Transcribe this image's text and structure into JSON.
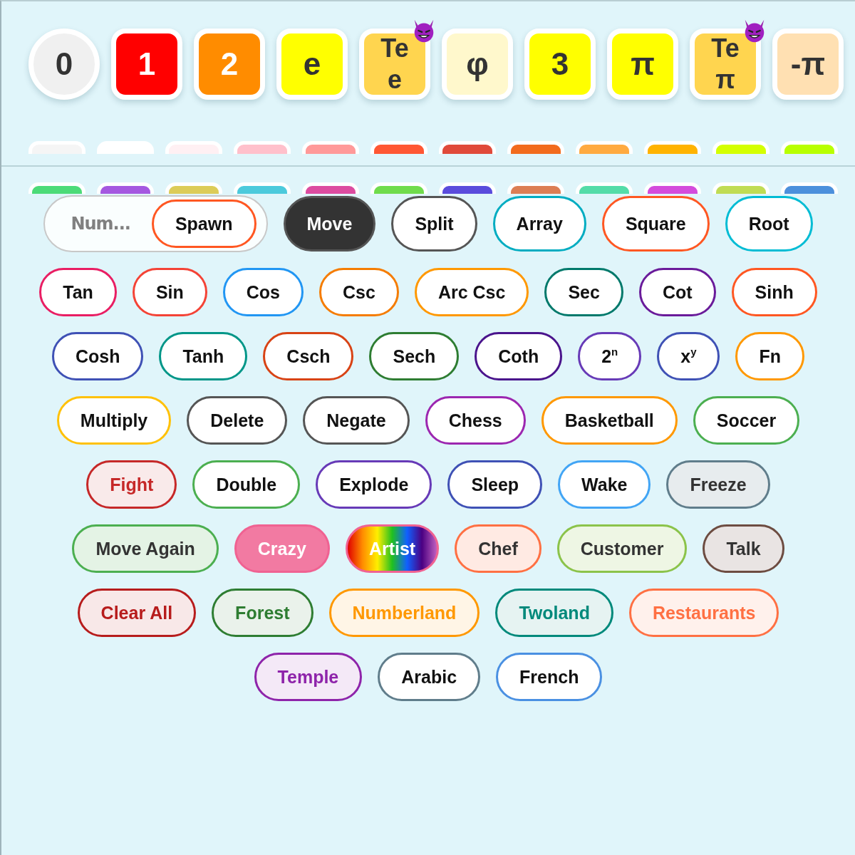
{
  "tiles": [
    {
      "label": "0",
      "kind": "circle",
      "color": "#f0f0f0"
    },
    {
      "label": "1",
      "kind": "square",
      "color": "#ff0000"
    },
    {
      "label": "2",
      "kind": "square",
      "color": "#ff8c00"
    },
    {
      "label": "e",
      "kind": "square",
      "color": "#ffff00"
    },
    {
      "label": "Te",
      "sublabel": "e",
      "kind": "square",
      "color": "#ffd54f",
      "badge": true
    },
    {
      "label": "φ",
      "kind": "square",
      "color": "#fff8cc"
    },
    {
      "label": "3",
      "kind": "square",
      "color": "#ffff00"
    },
    {
      "label": "π",
      "kind": "square",
      "color": "#ffff00"
    },
    {
      "label": "Te",
      "sublabel": "π",
      "kind": "square",
      "color": "#ffd54f",
      "badge": true
    },
    {
      "label": "-π",
      "kind": "square",
      "color": "#ffe0b2"
    }
  ],
  "swatch_rows": [
    [
      {
        "color": "#f5f5f5"
      },
      {
        "color": "#ffffff"
      },
      {
        "color": "#fff0f3"
      },
      {
        "color": "#ffc0cb"
      },
      {
        "color": "#ff9999"
      },
      {
        "color": "#ff5733"
      },
      {
        "color": "#e04a3a"
      },
      {
        "color": "#f26b1d"
      },
      {
        "color": "#ffaa40"
      },
      {
        "color": "#ffb300"
      },
      {
        "color": "#d4ff00"
      },
      {
        "color": "#b8ff00"
      }
    ],
    [
      {
        "color": "#4cdb78"
      },
      {
        "color": "#a558e0"
      },
      {
        "color": "#dccc58"
      },
      {
        "color": "#4ccadc"
      },
      {
        "color": "#dc4ca0"
      },
      {
        "color": "#70dc4c"
      },
      {
        "color": "#5a4cdc"
      },
      {
        "color": "#dc7e54"
      },
      {
        "color": "#54dca8"
      },
      {
        "color": "#d44cdc"
      },
      {
        "color": "#c0dc54"
      },
      {
        "color": "#4c90dc"
      }
    ]
  ],
  "button_rows": [
    [
      {
        "kind": "group",
        "label": "Num...",
        "button": {
          "label": "Spawn",
          "kind": "outline",
          "color": "#ff5722"
        }
      },
      {
        "label": "Move",
        "kind": "dark",
        "color": "#555555"
      },
      {
        "label": "Split",
        "kind": "outline",
        "color": "#555555"
      },
      {
        "label": "Array",
        "kind": "outline",
        "color": "#00acc1"
      },
      {
        "label": "Square",
        "kind": "outline",
        "color": "#ff5722"
      },
      {
        "label": "Root",
        "kind": "outline",
        "color": "#00bcd4"
      }
    ],
    [
      {
        "label": "Tan",
        "kind": "outline",
        "color": "#e91e63"
      },
      {
        "label": "Sin",
        "kind": "outline",
        "color": "#f44336"
      },
      {
        "label": "Cos",
        "kind": "outline",
        "color": "#2196f3"
      },
      {
        "label": "Csc",
        "kind": "outline",
        "color": "#f57c00"
      },
      {
        "label": "Arc Csc",
        "kind": "outline",
        "color": "#ff9800"
      },
      {
        "label": "Sec",
        "kind": "outline",
        "color": "#00796b"
      },
      {
        "label": "Cot",
        "kind": "outline",
        "color": "#6a1b9a"
      },
      {
        "label": "Sinh",
        "kind": "outline",
        "color": "#ff5722"
      }
    ],
    [
      {
        "label": "Cosh",
        "kind": "outline",
        "color": "#3f51b5"
      },
      {
        "label": "Tanh",
        "kind": "outline",
        "color": "#009688"
      },
      {
        "label": "Csch",
        "kind": "outline",
        "color": "#d84315"
      },
      {
        "label": "Sech",
        "kind": "outline",
        "color": "#2e7d32"
      },
      {
        "label": "Coth",
        "kind": "outline",
        "color": "#4a148c"
      },
      {
        "label": "2$^{n}$",
        "kind": "outline",
        "color": "#673ab7"
      },
      {
        "label": "x$^{y}$",
        "kind": "outline",
        "color": "#3f51b5"
      },
      {
        "label": "Fn",
        "kind": "outline",
        "color": "#ff9800"
      }
    ],
    [
      {
        "label": "Multiply",
        "kind": "outline",
        "color": "#ffc107"
      },
      {
        "label": "Delete",
        "kind": "outline",
        "color": "#555555"
      },
      {
        "label": "Negate",
        "kind": "outline",
        "color": "#555555"
      },
      {
        "label": "Chess",
        "kind": "outline",
        "color": "#9c27b0"
      },
      {
        "label": "Basketball",
        "kind": "outline",
        "color": "#ff9800"
      },
      {
        "label": "Soccer",
        "kind": "outline",
        "color": "#4caf50"
      }
    ],
    [
      {
        "label": "Fight",
        "kind": "tinted",
        "color": "#c62828"
      },
      {
        "label": "Double",
        "kind": "outline",
        "color": "#4caf50"
      },
      {
        "label": "Explode",
        "kind": "outline",
        "color": "#673ab7"
      },
      {
        "label": "Sleep",
        "kind": "outline",
        "color": "#3f51b5"
      },
      {
        "label": "Wake",
        "kind": "outline",
        "color": "#42a5f5"
      },
      {
        "label": "Freeze",
        "kind": "muted",
        "color": "#607d8b"
      }
    ],
    [
      {
        "label": "Move Again",
        "kind": "muted",
        "color": "#4caf50"
      },
      {
        "label": "Crazy",
        "kind": "solid",
        "color": "#f06292"
      },
      {
        "label": "Artist",
        "kind": "rainbow",
        "color": "#f06292"
      },
      {
        "label": "Chef",
        "kind": "muted",
        "color": "#ff7043"
      },
      {
        "label": "Customer",
        "kind": "muted",
        "color": "#8bc34a"
      },
      {
        "label": "Talk",
        "kind": "muted",
        "color": "#6d4c41"
      }
    ],
    [
      {
        "label": "Clear All",
        "kind": "tinted",
        "color": "#b71c1c"
      },
      {
        "label": "Forest",
        "kind": "tinted",
        "color": "#2e7d32"
      },
      {
        "label": "Numberland",
        "kind": "tinted",
        "color": "#ff9800"
      },
      {
        "label": "Twoland",
        "kind": "tinted",
        "color": "#00897b"
      },
      {
        "label": "Restaurants",
        "kind": "tinted",
        "color": "#ff7043"
      }
    ],
    [
      {
        "label": "Temple",
        "kind": "tinted",
        "color": "#8e24aa"
      },
      {
        "label": "Arabic",
        "kind": "outline",
        "color": "#607d8b"
      },
      {
        "label": "French",
        "kind": "outline",
        "color": "#4a90e2"
      }
    ]
  ]
}
